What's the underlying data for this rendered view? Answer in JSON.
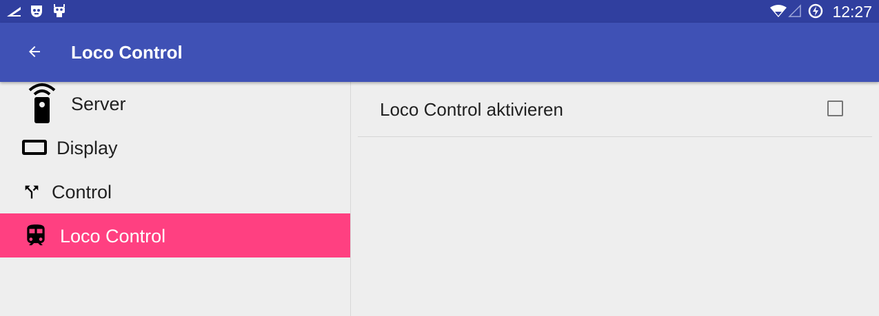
{
  "status_bar": {
    "time": "12:27",
    "left_icons": [
      "signal-edge-icon",
      "cyanogen-robot-icon",
      "cyanogen-android-icon"
    ],
    "right_icons": [
      "wifi-icon",
      "cell-signal-icon",
      "battery-charging-icon"
    ]
  },
  "app_bar": {
    "title": "Loco Control",
    "back_icon": "arrow-back-icon"
  },
  "sidebar": {
    "items": [
      {
        "label": "Server",
        "icon": "remote-control-icon",
        "active": false
      },
      {
        "label": "Display",
        "icon": "display-icon",
        "active": false
      },
      {
        "label": "Control",
        "icon": "call-split-icon",
        "active": false
      },
      {
        "label": "Loco Control",
        "icon": "train-icon",
        "active": true
      }
    ]
  },
  "content": {
    "preferences": [
      {
        "title": "Loco Control aktivieren",
        "checked": false
      }
    ]
  },
  "colors": {
    "status_bar": "#303f9f",
    "app_bar": "#3f51b5",
    "accent": "#ff4081",
    "background": "#eeeeee"
  }
}
